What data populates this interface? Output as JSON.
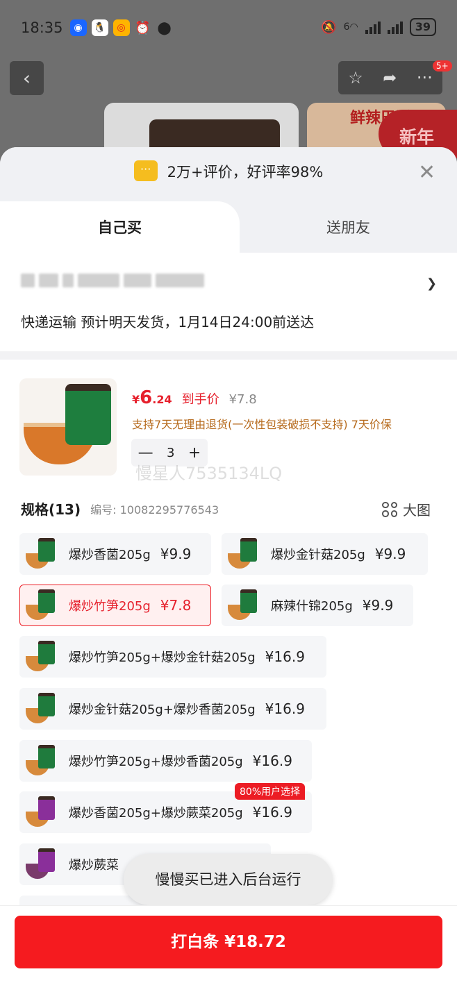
{
  "status_bar": {
    "time": "18:35",
    "battery": "39",
    "apps": [
      "browser-icon",
      "qq-icon",
      "weibo-icon",
      "alarm-icon",
      "location-icon"
    ],
    "network": "6"
  },
  "background_page": {
    "badge": "5+",
    "banner_text": "鲜辣巴适",
    "newyear_text": "新年"
  },
  "sheet": {
    "review_text": "2万+评价，好评率98%",
    "tabs": [
      {
        "label": "自己买",
        "active": true
      },
      {
        "label": "送朋友",
        "active": false
      }
    ],
    "shipping_text": "快递运输 预计明天发货，1月14日24:00前送达"
  },
  "product": {
    "price_symbol": "¥",
    "price_int": "6",
    "price_dec": ".24",
    "price_label": "到手价",
    "original_price": "¥7.8",
    "service_text": "支持7天无理由退货(一次性包装破损不支持) 7天价保",
    "quantity": "3",
    "watermark": "慢星人7535134LQ"
  },
  "spec": {
    "title": "规格(13)",
    "code_label": "编号: 10082295776543",
    "big_pic_label": "大图",
    "options": [
      {
        "name": "爆炒香菌205g",
        "price": "¥9.9",
        "selected": false
      },
      {
        "name": "爆炒金针菇205g",
        "price": "¥9.9",
        "selected": false
      },
      {
        "name": "爆炒竹笋205g",
        "price": "¥7.8",
        "selected": true
      },
      {
        "name": "麻辣什锦205g",
        "price": "¥9.9",
        "selected": false
      },
      {
        "name": "爆炒竹笋205g+爆炒金针菇205g",
        "price": "¥16.9",
        "selected": false
      },
      {
        "name": "爆炒金针菇205g+爆炒香菌205g",
        "price": "¥16.9",
        "selected": false
      },
      {
        "name": "爆炒竹笋205g+爆炒香菌205g",
        "price": "¥16.9",
        "selected": false
      },
      {
        "name": "爆炒香菌205g+爆炒蕨菜205g",
        "price": "¥16.9",
        "selected": false
      },
      {
        "name": "爆炒蕨菜",
        "price": "",
        "selected": false
      }
    ],
    "popular_tag": "80%用户选择"
  },
  "toast": "慢慢买已进入后台运行",
  "buy_button": "打白条 ¥18.72",
  "colors": {
    "accent": "#f51b1f",
    "service": "#b66a1c"
  }
}
